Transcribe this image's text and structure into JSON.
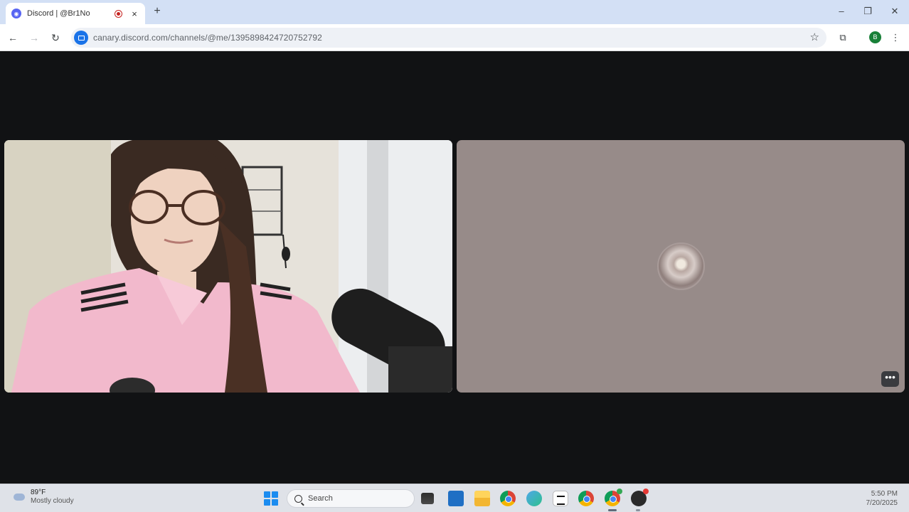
{
  "browser": {
    "tab_title": "Discord | @Br1No",
    "tab_close": "×",
    "new_tab": "+",
    "url": "canary.discord.com/channels/@me/1395898424720752792",
    "window_controls": {
      "minimize": "–",
      "maximize": "❐",
      "close": "✕"
    },
    "profile_initial": "B",
    "nav": {
      "back": "←",
      "forward": "→",
      "reload": "↻",
      "star": "☆",
      "cast": "⧉",
      "menu": "⋮"
    }
  },
  "call": {
    "more_button_label": "•••",
    "tiles": [
      {
        "type": "video",
        "name": "participant-video"
      },
      {
        "type": "avatar",
        "name": "participant-avatar"
      }
    ]
  },
  "taskbar": {
    "weather_temp": "89°F",
    "weather_desc": "Mostly cloudy",
    "search_label": "Search",
    "time": "5:50 PM",
    "date": "7/20/2025"
  },
  "colors": {
    "accent": "#1a73e8",
    "discord": "#5865f2",
    "tile_right_bg": "#978b89",
    "stage_bg": "#111214"
  }
}
